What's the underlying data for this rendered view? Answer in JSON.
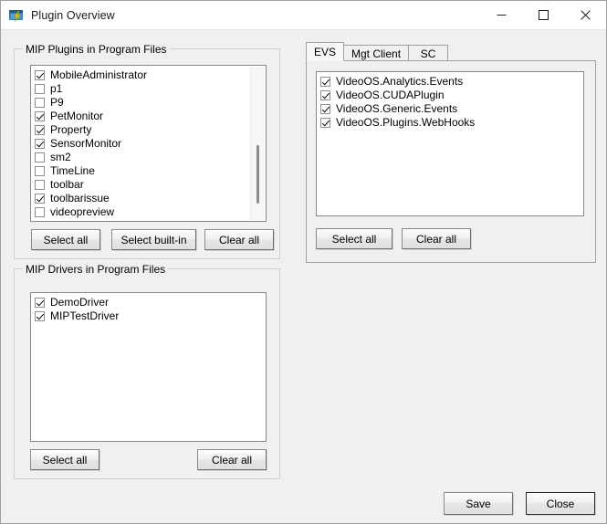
{
  "window": {
    "title": "Plugin Overview",
    "icon": "plugin-icon",
    "controls": {
      "minimize": "—",
      "maximize": "□",
      "close": "✕"
    }
  },
  "plugins_group": {
    "title": "MIP Plugins in Program Files",
    "items": [
      {
        "label": "MobileAdministrator",
        "checked": true
      },
      {
        "label": "p1",
        "checked": false
      },
      {
        "label": "P9",
        "checked": false
      },
      {
        "label": "PetMonitor",
        "checked": true
      },
      {
        "label": "Property",
        "checked": true
      },
      {
        "label": "SensorMonitor",
        "checked": true
      },
      {
        "label": "sm2",
        "checked": false
      },
      {
        "label": "TimeLine",
        "checked": false
      },
      {
        "label": "toolbar",
        "checked": false
      },
      {
        "label": "toolbarissue",
        "checked": true
      },
      {
        "label": "videopreview",
        "checked": false
      }
    ],
    "buttons": {
      "select_all": "Select all",
      "select_builtin": "Select built-in",
      "clear_all": "Clear all"
    }
  },
  "drivers_group": {
    "title": "MIP Drivers in Program Files",
    "items": [
      {
        "label": "DemoDriver",
        "checked": true
      },
      {
        "label": "MIPTestDriver",
        "checked": true
      }
    ],
    "buttons": {
      "select_all": "Select all",
      "clear_all": "Clear all"
    }
  },
  "tabpanel": {
    "tabs": [
      {
        "label": "EVS",
        "active": true
      },
      {
        "label": "Mgt Client",
        "active": false
      },
      {
        "label": "SC",
        "active": false
      }
    ],
    "items": [
      {
        "label": "VideoOS.Analytics.Events",
        "checked": true
      },
      {
        "label": "VideoOS.CUDAPlugin",
        "checked": true
      },
      {
        "label": "VideoOS.Generic.Events",
        "checked": true
      },
      {
        "label": "VideoOS.Plugins.WebHooks",
        "checked": true
      }
    ],
    "buttons": {
      "select_all": "Select all",
      "clear_all": "Clear all"
    }
  },
  "footer": {
    "save": "Save",
    "close": "Close"
  },
  "colors": {
    "window_bg": "#f0f0f0",
    "titlebar_bg": "#ffffff",
    "list_bg": "#ffffff",
    "border": "#a0a0a0",
    "icon_blue": "#1f6fa5",
    "icon_yellow": "#f2c200"
  }
}
